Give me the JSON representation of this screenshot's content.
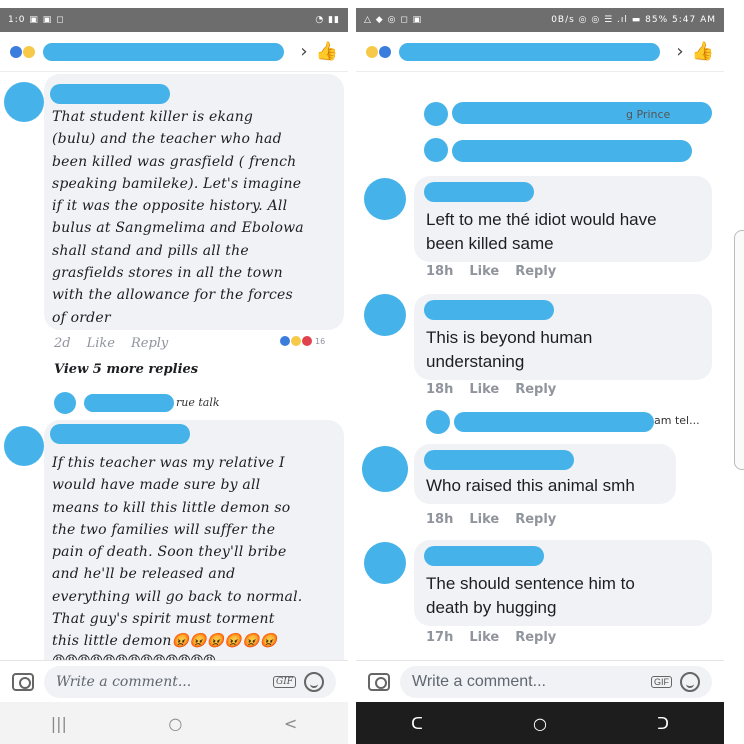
{
  "left": {
    "status": {
      "left_icons": "1:0 ▣ ▣ ◻",
      "right_icons": "◔ ▮▮"
    },
    "comments": [
      {
        "text": "That student killer is ekang\n(bulu) and the teacher who had\nbeen killed was grasfield ( french\nspeaking bamileke). Let's imagine\nif it was the opposite history. All\nbulus at Sangmelima and Ebolowa\nshall stand and pills all the\ngrasfields stores in all the town\nwith the allowance for the forces\nof order",
        "time": "2d",
        "like": "Like",
        "reply": "Reply",
        "reaction_count": "16"
      },
      {
        "text": "If this teacher was my relative I\nwould have made sure by all\nmeans to kill this little demon so\nthe two families will suffer the\npain of death. Soon they'll bribe\nand he'll be released and\neverything will go back to normal.\nThat guy's spirit must torment\nthis little demon😡😡😡😡😡😡",
        "emoji_row": "😡😡😡😡😡😡😡😡😡😡😡😡😡"
      }
    ],
    "more_replies": "View 5 more replies",
    "reply_snippet": "rue talk",
    "composer_placeholder": "Write a comment...",
    "gif_label": "GIF",
    "nav": {
      "recent": "|||",
      "home": "○",
      "back": "<"
    }
  },
  "right": {
    "status": {
      "left_icons": "△ ◆ ◎ ◻ ▣",
      "right_icons": "0B/s ◎ ◎ ☰ .ıl ▬ 85% 5:47 AM"
    },
    "reply_snippets": [
      {
        "text": "g Prince"
      },
      {
        "text": ""
      }
    ],
    "comments": [
      {
        "text": "Left to me thé idiot would have\nbeen killed same",
        "time": "18h",
        "like": "Like",
        "reply": "Reply"
      },
      {
        "text": "This is beyond human\nunderstaning",
        "time": "18h",
        "like": "Like",
        "reply": "Reply"
      },
      {
        "text": "Who raised this animal smh",
        "time": "18h",
        "like": "Like",
        "reply": "Reply"
      },
      {
        "text": "The should sentence him to\ndeath by hugging",
        "time": "17h",
        "like": "Like",
        "reply": "Reply"
      }
    ],
    "mid_reply_snippet": "am tel...",
    "composer_placeholder": "Write a comment...",
    "gif_label": "GIF",
    "nav": {
      "recent": "ᑕ",
      "home": "○",
      "back": "ᑐ"
    }
  }
}
